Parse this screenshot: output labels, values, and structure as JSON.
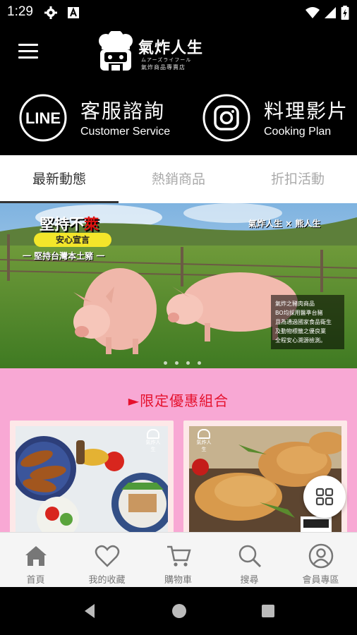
{
  "status_bar": {
    "time": "1:29"
  },
  "header": {
    "logo_title": "氣炸人生",
    "logo_sub1": "ムアーズライフール",
    "logo_sub2": "氣炸商品專賣店"
  },
  "contact": {
    "line_label": "LINE",
    "service_title": "客服諮詢",
    "service_sub": "Customer Service",
    "cooking_title": "料理影片",
    "cooking_sub": "Cooking Plan"
  },
  "tabs": [
    {
      "label": "最新動態",
      "active": true
    },
    {
      "label": "熱銷商品",
      "active": false
    },
    {
      "label": "折扣活動",
      "active": false
    }
  ],
  "banner": {
    "headline_prefix": "堅持不",
    "headline_highlight": "萊",
    "pill": "安心宣言",
    "subline": "一 堅持台灣本土豬 一",
    "logo_text": "氣炸人生 × 熊人生",
    "caption_lines": [
      "氣炸之豬肉商品",
      "BO均採用醫準台豬",
      "且為通過國家食品衛生",
      "及動物標籤之優良業",
      "全程安心溯源檢測。"
    ],
    "slide_count": 4
  },
  "promo": {
    "title": "►限定優惠組合",
    "card_logo_text": "氣炸人生"
  },
  "bottom_nav": [
    {
      "label": "首頁",
      "icon": "home-icon"
    },
    {
      "label": "我的收藏",
      "icon": "heart-icon"
    },
    {
      "label": "購物車",
      "icon": "cart-icon"
    },
    {
      "label": "搜尋",
      "icon": "search-icon"
    },
    {
      "label": "會員專區",
      "icon": "user-icon"
    }
  ],
  "colors": {
    "promo_bg": "#f8a8d4",
    "promo_title": "#e5112d",
    "highlight_pill": "#f3e62a"
  }
}
